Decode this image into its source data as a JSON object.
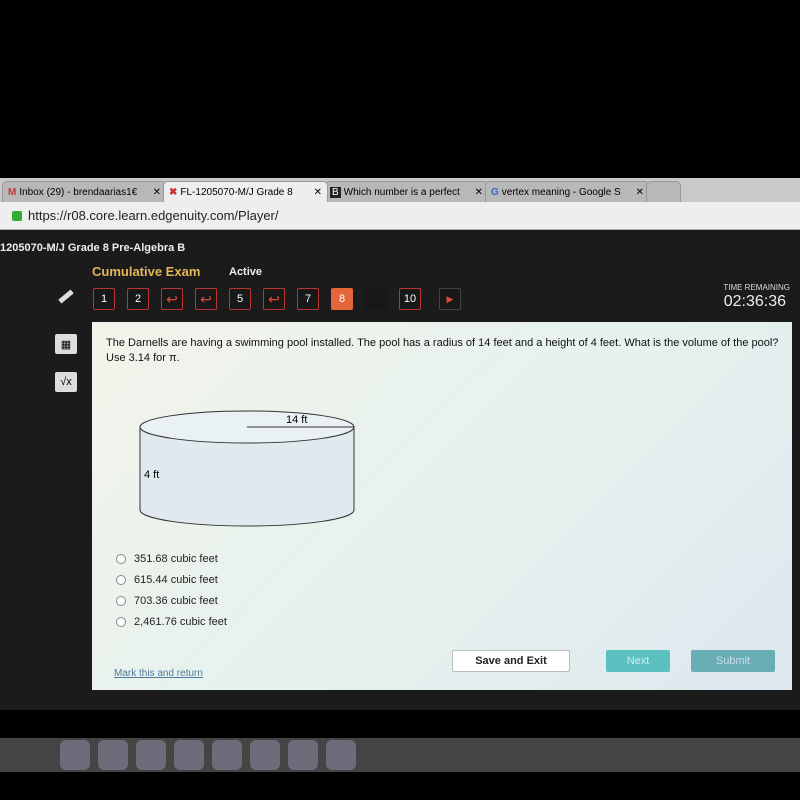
{
  "browser": {
    "tabs": [
      {
        "label": "Inbox (29) - brendaarias1€",
        "icon": "gmail-icon",
        "active": false
      },
      {
        "label": "FL-1205070-M/J Grade 8",
        "icon": "edgenuity-icon",
        "active": true
      },
      {
        "label": "Which number is a perfect",
        "icon": "brainly-icon",
        "active": false
      },
      {
        "label": "vertex meaning - Google S",
        "icon": "google-icon",
        "active": false
      }
    ],
    "url": "https://r08.core.learn.edgenuity.com/Player/"
  },
  "app": {
    "course": "1205070-M/J Grade 8 Pre-Algebra B",
    "exam": "Cumulative Exam",
    "status": "Active",
    "questions": [
      {
        "label": "1",
        "type": "number"
      },
      {
        "label": "2",
        "type": "number"
      },
      {
        "label": "",
        "type": "back"
      },
      {
        "label": "",
        "type": "back"
      },
      {
        "label": "5",
        "type": "number"
      },
      {
        "label": "",
        "type": "back"
      },
      {
        "label": "7",
        "type": "number"
      },
      {
        "label": "8",
        "type": "current"
      },
      {
        "label": "",
        "type": "blank"
      },
      {
        "label": "10",
        "type": "number"
      }
    ],
    "time_label": "TIME REMAINING",
    "time": "02:36:36",
    "accent": "#e5643a"
  },
  "question": {
    "text": "The Darnells are having a swimming pool installed. The pool has a radius of 14 feet and a height of 4 feet. What is the volume of the pool? Use 3.14 for π.",
    "radius_label": "14 ft",
    "height_label": "4 ft",
    "options": [
      "351.68 cubic feet",
      "615.44 cubic feet",
      "703.36 cubic feet",
      "2,461.76 cubic feet"
    ]
  },
  "footer": {
    "mark": "Mark this and return",
    "save": "Save and Exit",
    "next": "Next",
    "submit": "Submit"
  }
}
